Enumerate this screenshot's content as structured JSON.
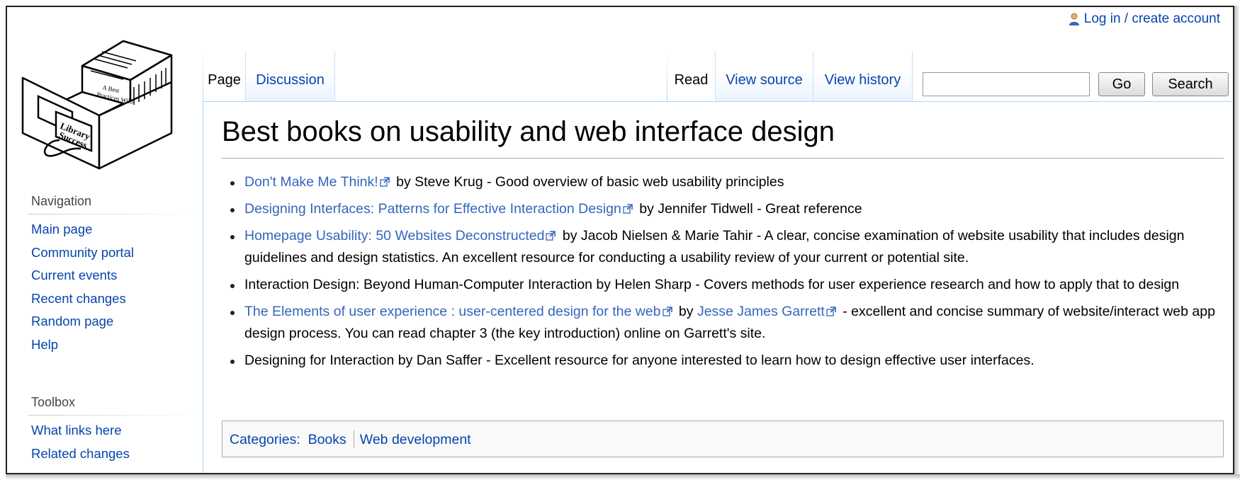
{
  "personal": {
    "login_label": "Log in / create account"
  },
  "logo": {
    "text_line1": "A Best",
    "text_line2": "Practices Wiki",
    "sign_line1": "Library",
    "sign_line2": "Success"
  },
  "tabs": {
    "left": [
      {
        "label": "Page",
        "selected": true
      },
      {
        "label": "Discussion",
        "selected": false
      }
    ],
    "right": [
      {
        "label": "Read",
        "selected": true
      },
      {
        "label": "View source",
        "selected": false
      },
      {
        "label": "View history",
        "selected": false
      }
    ]
  },
  "search": {
    "value": "",
    "go_label": "Go",
    "search_label": "Search"
  },
  "sidebar": {
    "navigation": {
      "heading": "Navigation",
      "items": [
        "Main page",
        "Community portal",
        "Current events",
        "Recent changes",
        "Random page",
        "Help"
      ]
    },
    "toolbox": {
      "heading": "Toolbox",
      "items": [
        "What links here",
        "Related changes"
      ]
    }
  },
  "page": {
    "title": "Best books on usability and web interface design",
    "books": [
      {
        "link": "Don't Make Me Think!",
        "rest": " by Steve Krug - Good overview of basic web usability principles"
      },
      {
        "link": "Designing Interfaces: Patterns for Effective Interaction Design",
        "rest": " by Jennifer Tidwell - Great reference"
      },
      {
        "link": "Homepage Usability: 50 Websites Deconstructed",
        "rest": " by Jacob Nielsen & Marie Tahir - A clear, concise examination of website usability that includes design guidelines and design statistics. An excellent resource for conducting a usability review of your current or potential site."
      },
      {
        "text": "Interaction Design: Beyond Human-Computer Interaction by Helen Sharp - Covers methods for user experience research and how to apply that to design"
      },
      {
        "link": "The Elements of user experience : user-centered design for the web",
        "mid": " by ",
        "link2": "Jesse James Garrett",
        "rest": " - excellent and concise summary of website/interact web app design process. You can read chapter 3 (the key introduction) online on Garrett's site."
      },
      {
        "text": "Designing for Interaction by Dan Saffer - Excellent resource for anyone interested to learn how to design effective user interfaces."
      }
    ],
    "categories": {
      "label": "Categories",
      "items": [
        "Books",
        "Web development"
      ]
    }
  },
  "colors": {
    "link": "#0645ad",
    "external_link": "#3366bb",
    "tab_border": "#a7d7f9"
  }
}
